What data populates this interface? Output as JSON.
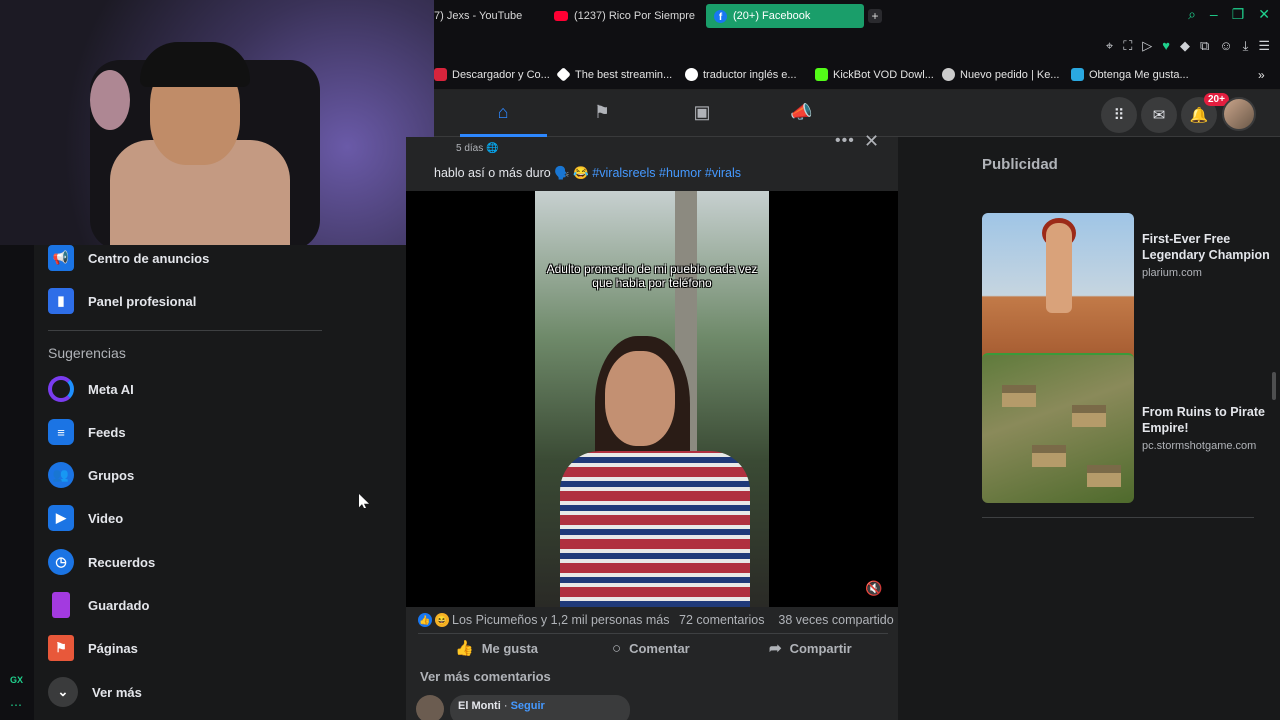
{
  "browser": {
    "tabs": [
      {
        "label": "7) Jexs - YouTube",
        "active": false
      },
      {
        "label": "(1237) Rico Por Siempre",
        "active": false
      },
      {
        "label": "(20+) Facebook",
        "active": true
      }
    ],
    "bookmarks": [
      {
        "label": "Descargador y Co...",
        "icon": "red-square-icon"
      },
      {
        "label": "The best streamin...",
        "icon": "diamond-icon"
      },
      {
        "label": "traductor inglés e...",
        "icon": "google-icon"
      },
      {
        "label": "KickBot VOD Dowl...",
        "icon": "kick-icon"
      },
      {
        "label": "Nuevo pedido | Ke...",
        "icon": "avatar-icon"
      },
      {
        "label": "Obtenga Me gusta...",
        "icon": "b-icon"
      }
    ],
    "accent_color": "#1a9e6a"
  },
  "header": {
    "notifications_badge": "20+",
    "nav_icons": [
      "home-icon",
      "flag-icon",
      "video-gallery-icon",
      "megaphone-icon"
    ]
  },
  "sidebar": {
    "items_top": [
      {
        "label": "Centro de anuncios",
        "icon": "megaphone-icon"
      },
      {
        "label": "Panel profesional",
        "icon": "bar-chart-icon"
      }
    ],
    "section_title": "Sugerencias",
    "items": [
      {
        "label": "Meta AI",
        "icon": "meta-ai-ring-icon"
      },
      {
        "label": "Feeds",
        "icon": "feeds-icon"
      },
      {
        "label": "Grupos",
        "icon": "groups-icon"
      },
      {
        "label": "Video",
        "icon": "video-play-icon"
      },
      {
        "label": "Recuerdos",
        "icon": "clock-icon"
      },
      {
        "label": "Guardado",
        "icon": "bookmark-icon"
      },
      {
        "label": "Páginas",
        "icon": "flag-icon"
      },
      {
        "label": "Ver más",
        "icon": "chevron-down-icon"
      }
    ],
    "gx_label": "GX"
  },
  "post": {
    "time": "5 días",
    "caption_text": "hablo así o más duro 🗣️ 😂 ",
    "hashtags": [
      "#viralsreels",
      "#humor",
      "#virals"
    ],
    "video_overlay_text": "Adulto promedio de mi pueblo cada vez que habla por teléfono",
    "reactions_text": "Los Picumeños y 1,2 mil personas más",
    "comments_count": "72 comentarios",
    "shares_count": "38 veces compartido",
    "actions": {
      "like": "Me gusta",
      "comment": "Comentar",
      "share": "Compartir"
    },
    "more_comments": "Ver más comentarios",
    "comment": {
      "author": "El Monti",
      "follow": "Seguir"
    }
  },
  "sponsored": {
    "title": "Publicidad",
    "ads": [
      {
        "name": "First-Ever Free Legendary Champion",
        "url": "plarium.com"
      },
      {
        "name": "From Ruins to Pirate Empire!",
        "url": "pc.stormshotgame.com"
      }
    ]
  }
}
